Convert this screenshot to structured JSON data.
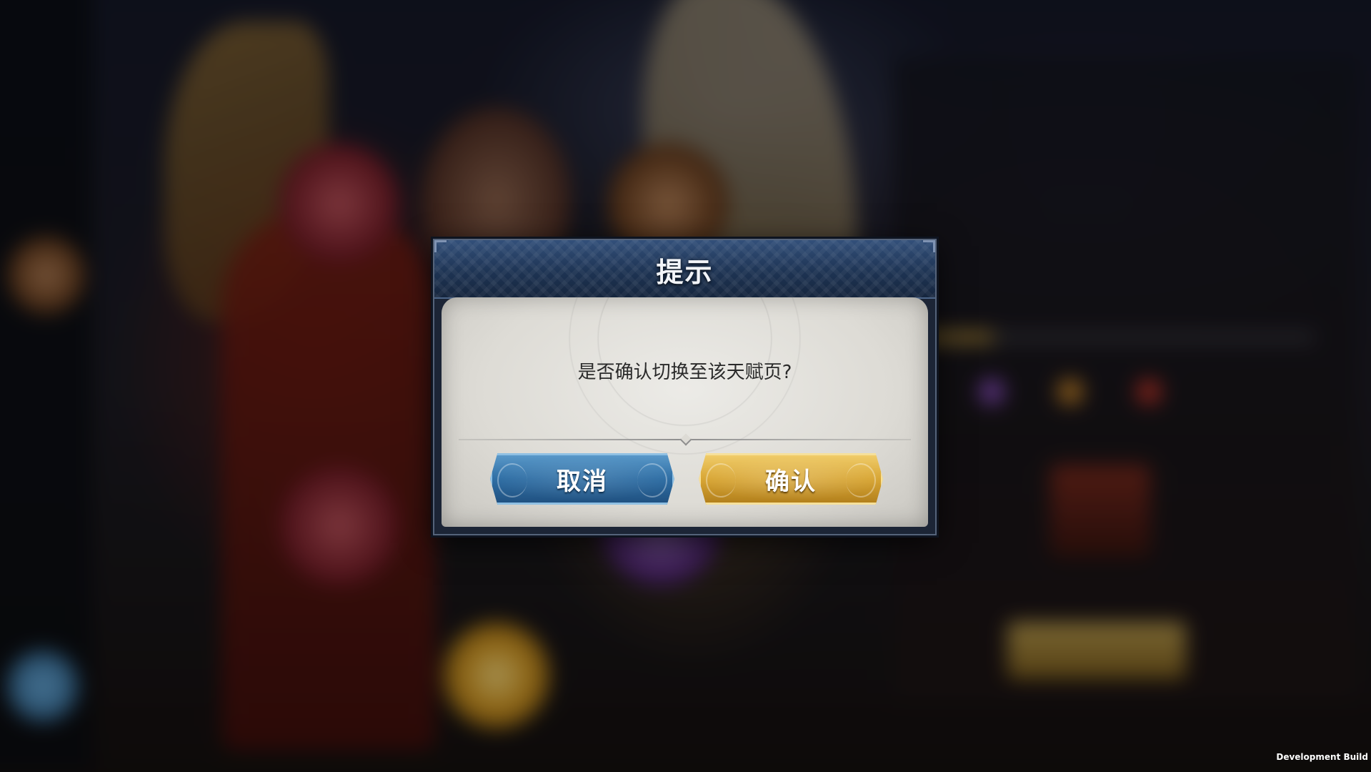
{
  "dialog": {
    "title": "提示",
    "message": "是否确认切换至该天赋页?",
    "cancel_label": "取消",
    "confirm_label": "确认"
  },
  "watermark": {
    "text": "Development Build"
  },
  "colors": {
    "cancel_button": "#2f6ea4",
    "confirm_button": "#d8a635",
    "dialog_header": "#1e3454",
    "dialog_body": "#dddbd5"
  }
}
